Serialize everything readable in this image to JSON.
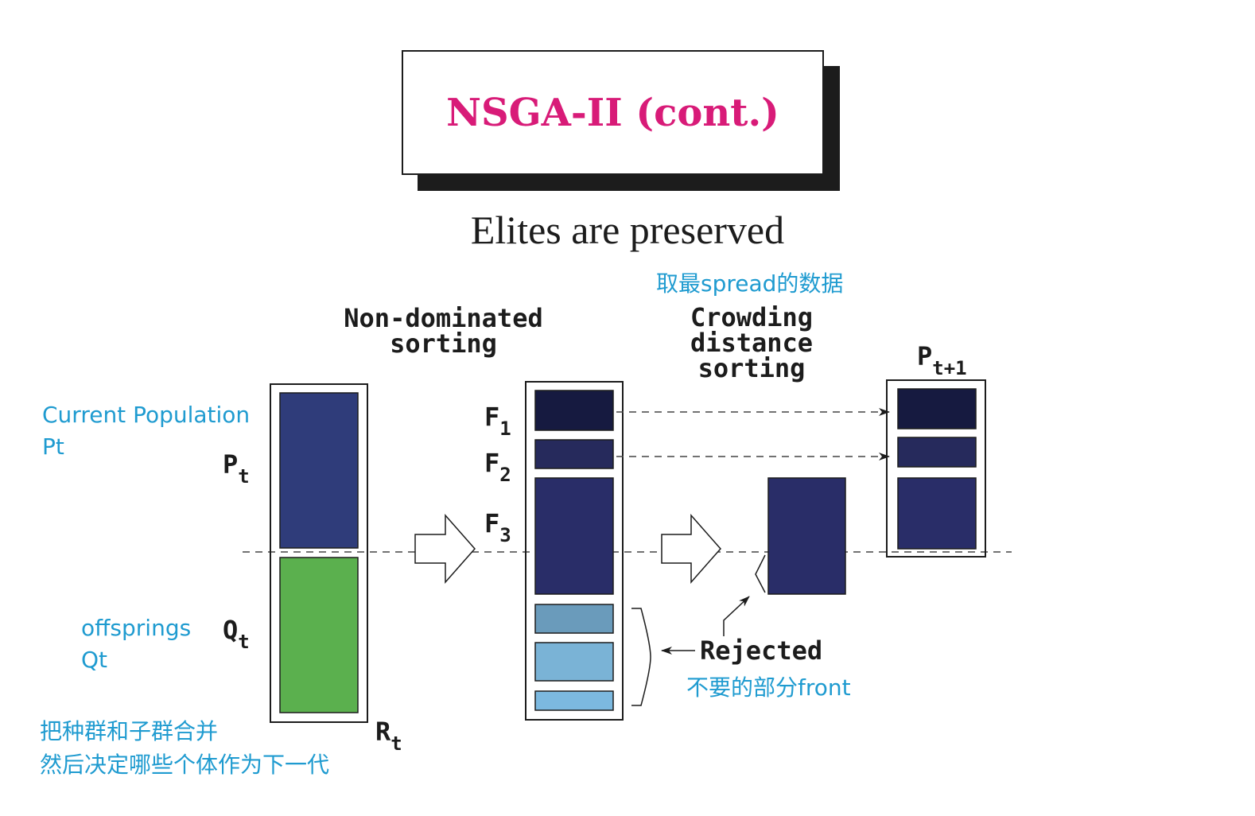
{
  "title": "NSGA-II (cont.)",
  "subtitle": "Elites are preserved",
  "stage_labels": {
    "nondominated": [
      "Non-dominated",
      "sorting"
    ],
    "crowding": [
      "Crowding",
      "distance",
      "sorting"
    ]
  },
  "population_labels": {
    "pt": {
      "main": "P",
      "sub": "t"
    },
    "qt": {
      "main": "Q",
      "sub": "t"
    },
    "rt": {
      "main": "R",
      "sub": "t"
    },
    "pt1": {
      "main": "P",
      "sub": "t+1"
    }
  },
  "front_labels": [
    {
      "main": "F",
      "sub": "1"
    },
    {
      "main": "F",
      "sub": "2"
    },
    {
      "main": "F",
      "sub": "3"
    }
  ],
  "rejected_label": "Rejected",
  "annotations": {
    "current_population": [
      "Current Population",
      "Pt"
    ],
    "offsprings": [
      "offsprings",
      "Qt"
    ],
    "merge_note": [
      "把种群和子群合并",
      "然后决定哪些个体作为下一代"
    ],
    "spread_note": "取最spread的数据",
    "rejected_note": "不要的部分front"
  },
  "colors": {
    "title": "#d81b78",
    "annotation": "#1f9bd0",
    "pt_block": "#2f3c7a",
    "qt_block": "#5bb04e",
    "f1": "#161a40",
    "f2": "#262a5c",
    "f3": "#292d68",
    "rejected_1": "#6a9bbb",
    "rejected_2": "#7ab3d6",
    "rejected_3": "#7cb9e0"
  }
}
